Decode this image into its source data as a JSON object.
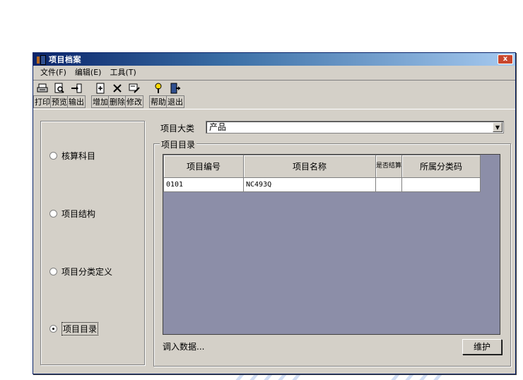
{
  "window": {
    "title": "项目档案",
    "close_label": "x"
  },
  "menu": [
    {
      "label": "文件(F)"
    },
    {
      "label": "编辑(E)"
    },
    {
      "label": "工具(T)"
    }
  ],
  "toolbar": [
    {
      "label": "打印",
      "icon": "printer-icon"
    },
    {
      "label": "预览",
      "icon": "preview-icon"
    },
    {
      "label": "输出",
      "icon": "export-icon"
    },
    {
      "label": "增加",
      "icon": "add-icon"
    },
    {
      "label": "删除",
      "icon": "delete-icon"
    },
    {
      "label": "修改",
      "icon": "edit-icon"
    },
    {
      "label": "帮助",
      "icon": "help-icon"
    },
    {
      "label": "退出",
      "icon": "exit-icon"
    }
  ],
  "left_panel": {
    "options": [
      {
        "label": "核算科目",
        "checked": false
      },
      {
        "label": "项目结构",
        "checked": false
      },
      {
        "label": "项目分类定义",
        "checked": false
      },
      {
        "label": "项目目录",
        "checked": true
      }
    ]
  },
  "category": {
    "label": "项目大类",
    "value": "产品"
  },
  "directory": {
    "title": "项目目录",
    "columns": [
      "项目编号",
      "项目名称",
      "是否结算",
      "所属分类码"
    ],
    "rows": [
      {
        "code": "0101",
        "name": "NC493Q",
        "settled": "",
        "class": ""
      }
    ]
  },
  "status": {
    "text": "调入数据..."
  },
  "buttons": {
    "maintain": "维护"
  },
  "colors": {
    "grid_background": "#8c8ea8",
    "titlebar": "#0a246a"
  }
}
